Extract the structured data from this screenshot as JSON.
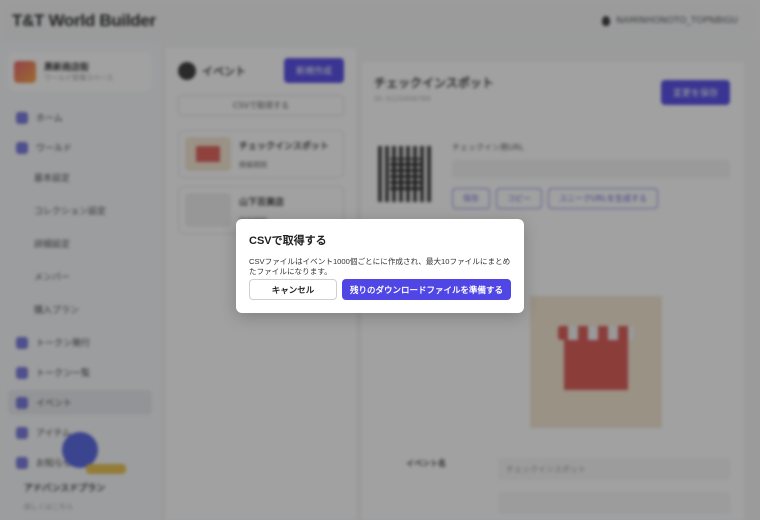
{
  "app": {
    "logo": "T&T World Builder",
    "user_label": "NAMINHONOTO_TOPNBIGU"
  },
  "sidebar": {
    "org_name": "黒新商店街",
    "org_sub": "ワールド管理スペース",
    "items": [
      {
        "label": "ホーム",
        "icon": "home-icon"
      },
      {
        "label": "ワールド",
        "icon": "globe-icon"
      },
      {
        "label": "基本設定",
        "sub": true
      },
      {
        "label": "コレクション設定",
        "sub": true
      },
      {
        "label": "詳細設定",
        "sub": true
      },
      {
        "label": "メンバー",
        "sub": true
      },
      {
        "label": "購入プラン",
        "sub": true
      },
      {
        "label": "トークン発行",
        "icon": "token-icon"
      },
      {
        "label": "トークン一覧",
        "icon": "list-icon"
      },
      {
        "label": "イベント",
        "icon": "event-icon",
        "active": true
      },
      {
        "label": "アイテム",
        "icon": "item-icon"
      },
      {
        "label": "お知らせ",
        "icon": "bell-icon"
      }
    ],
    "promo_title": "アドバンスドプラン",
    "promo_note": "詳しくはこちら"
  },
  "events": {
    "title": "イベント",
    "new_button": "新規作成",
    "csv_button": "CSVで取得する",
    "cards": [
      {
        "title": "チェックインスポット",
        "badge": "開催期間"
      },
      {
        "title": "山下百貨店",
        "badge": "開催期間"
      }
    ]
  },
  "detail": {
    "title": "チェックインスポット",
    "subtitle": "ID: 0123456789",
    "save_button": "変更を保存",
    "url_label": "チェックイン用URL",
    "actions": [
      "保存",
      "コピー",
      "ユニークURLを生成する"
    ],
    "event_name_label": "イベント名",
    "event_name_value": "チェックインスポット"
  },
  "modal": {
    "title": "CSVで取得する",
    "body": "CSVファイルはイベント1000個ごとにに作成され、最大10ファイルにまとめたファイルになります。",
    "cancel": "キャンセル",
    "confirm": "残りのダウンロードファイルを準備する"
  },
  "colors": {
    "accent": "#4f46e5",
    "overlay": "#1e1e1e"
  }
}
